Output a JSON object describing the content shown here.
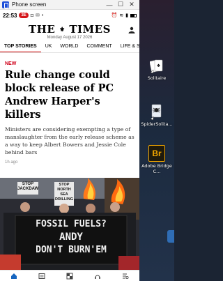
{
  "window": {
    "title": "Phone screen",
    "minimize": "—",
    "maximize": "☐",
    "close": "✕"
  },
  "status": {
    "time": "22:53",
    "live_badge": "3E",
    "battery": ""
  },
  "masthead": {
    "brand_left": "THE",
    "brand_right": "TIMES",
    "date": "Monday August 17 2026"
  },
  "nav": {
    "items": [
      "TOP STORIES",
      "UK",
      "WORLD",
      "COMMENT",
      "LIFE & ST"
    ]
  },
  "article": {
    "kicker": "NEW",
    "headline": "Rule change could block release of PC Andrew Harper's killers",
    "standfirst": "Ministers are considering exempting a type of manslaughter from the early release scheme as a way to keep Albert Bowers and Jessie Cole behind bars",
    "time_ago": "1h ago"
  },
  "photo": {
    "banner_line1": "FOSSIL FUELS?",
    "banner_line2": "ANDY",
    "banner_line3": "DON'T BURN'EM",
    "sign1": "STOP",
    "sign1b": "JACKDAW",
    "sign2": "STOP",
    "sign2b": "NORTH",
    "sign2c": "SEA",
    "sign2d": "DRILLING"
  },
  "bottom_nav": [
    "home-icon",
    "news-icon",
    "puzzle-icon",
    "podcast-icon",
    "saved-list-icon"
  ],
  "desktop": {
    "icons": [
      {
        "name": "Solitaire"
      },
      {
        "name": "SpiderSolita..."
      },
      {
        "name": "Adobe Bridge C..."
      }
    ],
    "bridge_abbr": "Br"
  },
  "colors": {
    "accent": "#c00000",
    "kicker": "#d0021b",
    "bridge": "#f0a500"
  }
}
